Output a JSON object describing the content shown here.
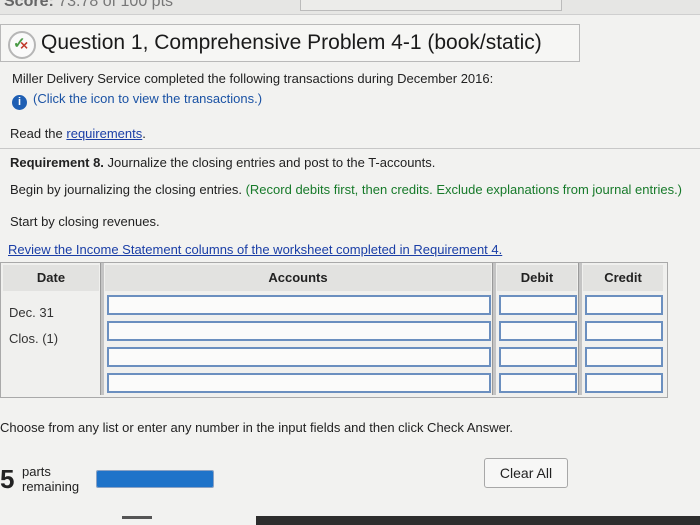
{
  "top": {
    "score_label": "Score:",
    "score_value": "73.78 of 100 pts"
  },
  "question": {
    "title": "Question 1, Comprehensive Problem 4-1 (book/static)"
  },
  "intro": "Miller Delivery Service completed the following transactions during December 2016:",
  "info_link": "(Click the icon to view the transactions.)",
  "read_prefix": "Read the",
  "requirements_link": "requirements",
  "requirements_suffix": ".",
  "req8_bold": "Requirement 8.",
  "req8_text": "Journalize the closing entries and post to the T-accounts.",
  "begin_text": "Begin by journalizing the closing entries.",
  "begin_green": "(Record debits first, then credits. Exclude explanations from journal entries.)",
  "start_text": "Start by closing revenues.",
  "review_link": "Review the Income Statement columns of the worksheet completed in Requirement 4.",
  "table": {
    "headers": {
      "date": "Date",
      "accounts": "Accounts",
      "debit": "Debit",
      "credit": "Credit"
    },
    "date_lines": [
      "Dec. 31",
      "Clos. (1)"
    ]
  },
  "instructions": "Choose from any list or enter any number in the input fields and then click Check Answer.",
  "parts": {
    "count": "5",
    "label_line1": "parts",
    "label_line2": "remaining",
    "progress_fraction": 1.0
  },
  "clear_button": "Clear All",
  "colors": {
    "link": "#1a3ea6",
    "green_text": "#177a2a",
    "field_border": "#6b8fbf",
    "progress": "#1e73c9"
  }
}
